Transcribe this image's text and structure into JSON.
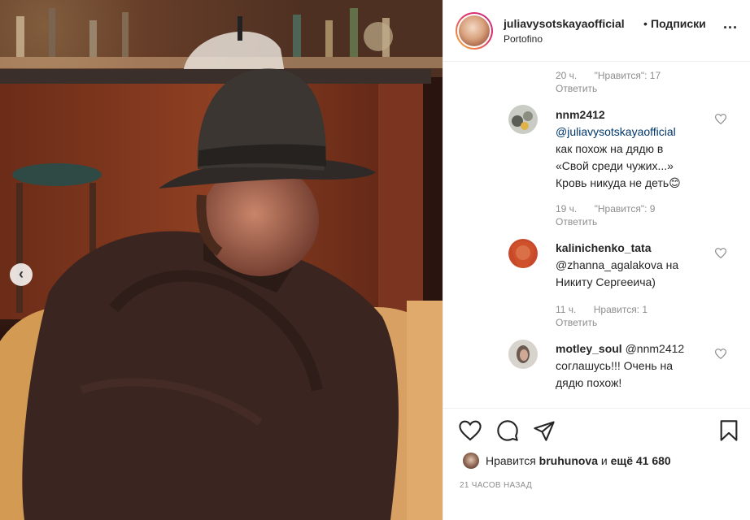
{
  "post": {
    "username": "juliavysotskayaofficial",
    "separator": "•",
    "follow_label": "Подписки",
    "location": "Portofino",
    "more_label": "..."
  },
  "comments": [
    {
      "partial": true,
      "time": "20 ч.",
      "likes": "\"Нравится\": 17",
      "reply": "Ответить"
    },
    {
      "username": "nnm2412",
      "lines": [
        "@juliavysotskayaofficial",
        "как похож на дядю в",
        "«Свой среди чужих...»",
        "Кровь никуда не деть😊"
      ],
      "time": "19 ч.",
      "likes": "\"Нравится\": 9",
      "reply": "Ответить"
    },
    {
      "username": "kalinichenko_tata",
      "lines": [
        "@zhanna_agalakova на",
        "Никиту Сергееича)"
      ],
      "time": "11 ч.",
      "likes": "Нравится: 1",
      "reply": "Ответить"
    },
    {
      "username": "motley_soul",
      "first_line_rest": "@nnm2412",
      "lines": [
        "соглашусь!!! Очень на",
        "дядю похож!"
      ]
    }
  ],
  "likes_summary": {
    "prefix": "Нравится",
    "user": "bruhunova",
    "middle": "и",
    "rest": "ещё 41 680"
  },
  "posted_time": "21 часов назад",
  "icons": {
    "prev": "chevron-left-icon",
    "like": "heart-icon",
    "comment": "comment-icon",
    "share": "paper-plane-icon",
    "save": "bookmark-icon"
  }
}
